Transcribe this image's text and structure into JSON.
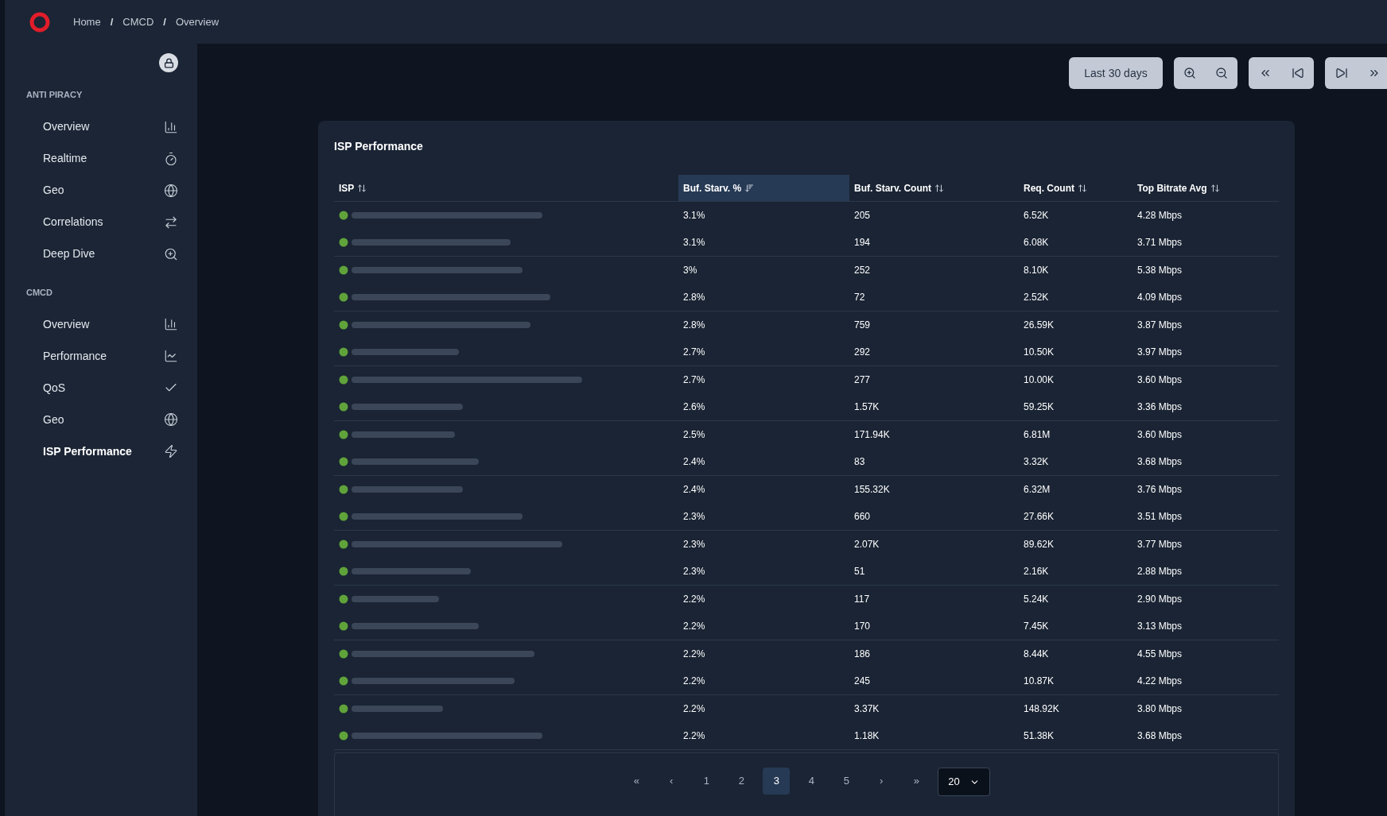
{
  "breadcrumb": [
    "Home",
    "CMCD",
    "Overview"
  ],
  "breadcrumb_separator": "/",
  "sidebar": {
    "sections": [
      {
        "title": "ANTI PIRACY",
        "items": [
          {
            "label": "Overview",
            "selected": false
          },
          {
            "label": "Realtime",
            "selected": false
          },
          {
            "label": "Geo",
            "selected": false
          },
          {
            "label": "Correlations",
            "selected": false
          },
          {
            "label": "Deep Dive",
            "selected": false
          }
        ]
      },
      {
        "title": "CMCD",
        "items": [
          {
            "label": "Overview",
            "selected": false
          },
          {
            "label": "Performance",
            "selected": false
          },
          {
            "label": "QoS",
            "selected": false
          },
          {
            "label": "Geo",
            "selected": false
          },
          {
            "label": "ISP Performance",
            "selected": true
          }
        ]
      }
    ]
  },
  "toolbar": {
    "range": "Last 30 days"
  },
  "panel": {
    "title": "ISP Performance",
    "columns": [
      {
        "label": "ISP",
        "sorted": false
      },
      {
        "label": "Buf. Starv. %",
        "sorted": true
      },
      {
        "label": "Buf. Starv. Count",
        "sorted": false
      },
      {
        "label": "Req. Count",
        "sorted": false
      },
      {
        "label": "Top Bitrate Avg",
        "sorted": false
      }
    ],
    "rows": [
      [
        "",
        "3.1%",
        "205",
        "6.52K",
        "4.28 Mbps"
      ],
      [
        "",
        "3.1%",
        "194",
        "6.08K",
        "3.71 Mbps"
      ],
      [
        "",
        "3%",
        "252",
        "8.10K",
        "5.38 Mbps"
      ],
      [
        "",
        "2.8%",
        "72",
        "2.52K",
        "4.09 Mbps"
      ],
      [
        "",
        "2.8%",
        "759",
        "26.59K",
        "3.87 Mbps"
      ],
      [
        "",
        "2.7%",
        "292",
        "10.50K",
        "3.97 Mbps"
      ],
      [
        "",
        "2.7%",
        "277",
        "10.00K",
        "3.60 Mbps"
      ],
      [
        "",
        "2.6%",
        "1.57K",
        "59.25K",
        "3.36 Mbps"
      ],
      [
        "",
        "2.5%",
        "171.94K",
        "6.81M",
        "3.60 Mbps"
      ],
      [
        "",
        "2.4%",
        "83",
        "3.32K",
        "3.68 Mbps"
      ],
      [
        "",
        "2.4%",
        "155.32K",
        "6.32M",
        "3.76 Mbps"
      ],
      [
        "",
        "2.3%",
        "660",
        "27.66K",
        "3.51 Mbps"
      ],
      [
        "",
        "2.3%",
        "2.07K",
        "89.62K",
        "3.77 Mbps"
      ],
      [
        "",
        "2.3%",
        "51",
        "2.16K",
        "2.88 Mbps"
      ],
      [
        "",
        "2.2%",
        "117",
        "5.24K",
        "2.90 Mbps"
      ],
      [
        "",
        "2.2%",
        "170",
        "7.45K",
        "3.13 Mbps"
      ],
      [
        "",
        "2.2%",
        "186",
        "8.44K",
        "4.55 Mbps"
      ],
      [
        "",
        "2.2%",
        "245",
        "10.87K",
        "4.22 Mbps"
      ],
      [
        "",
        "2.2%",
        "3.37K",
        "148.92K",
        "3.80 Mbps"
      ],
      [
        "",
        "2.2%",
        "1.18K",
        "51.38K",
        "3.68 Mbps"
      ]
    ],
    "pagination": {
      "first": "«",
      "prev": "‹",
      "pages": [
        {
          "label": "1",
          "selected": false
        },
        {
          "label": "2",
          "selected": false
        },
        {
          "label": "3",
          "selected": true
        },
        {
          "label": "4",
          "selected": false
        },
        {
          "label": "5",
          "selected": false
        }
      ],
      "next": "›",
      "last": "»",
      "page_size": "20"
    }
  }
}
